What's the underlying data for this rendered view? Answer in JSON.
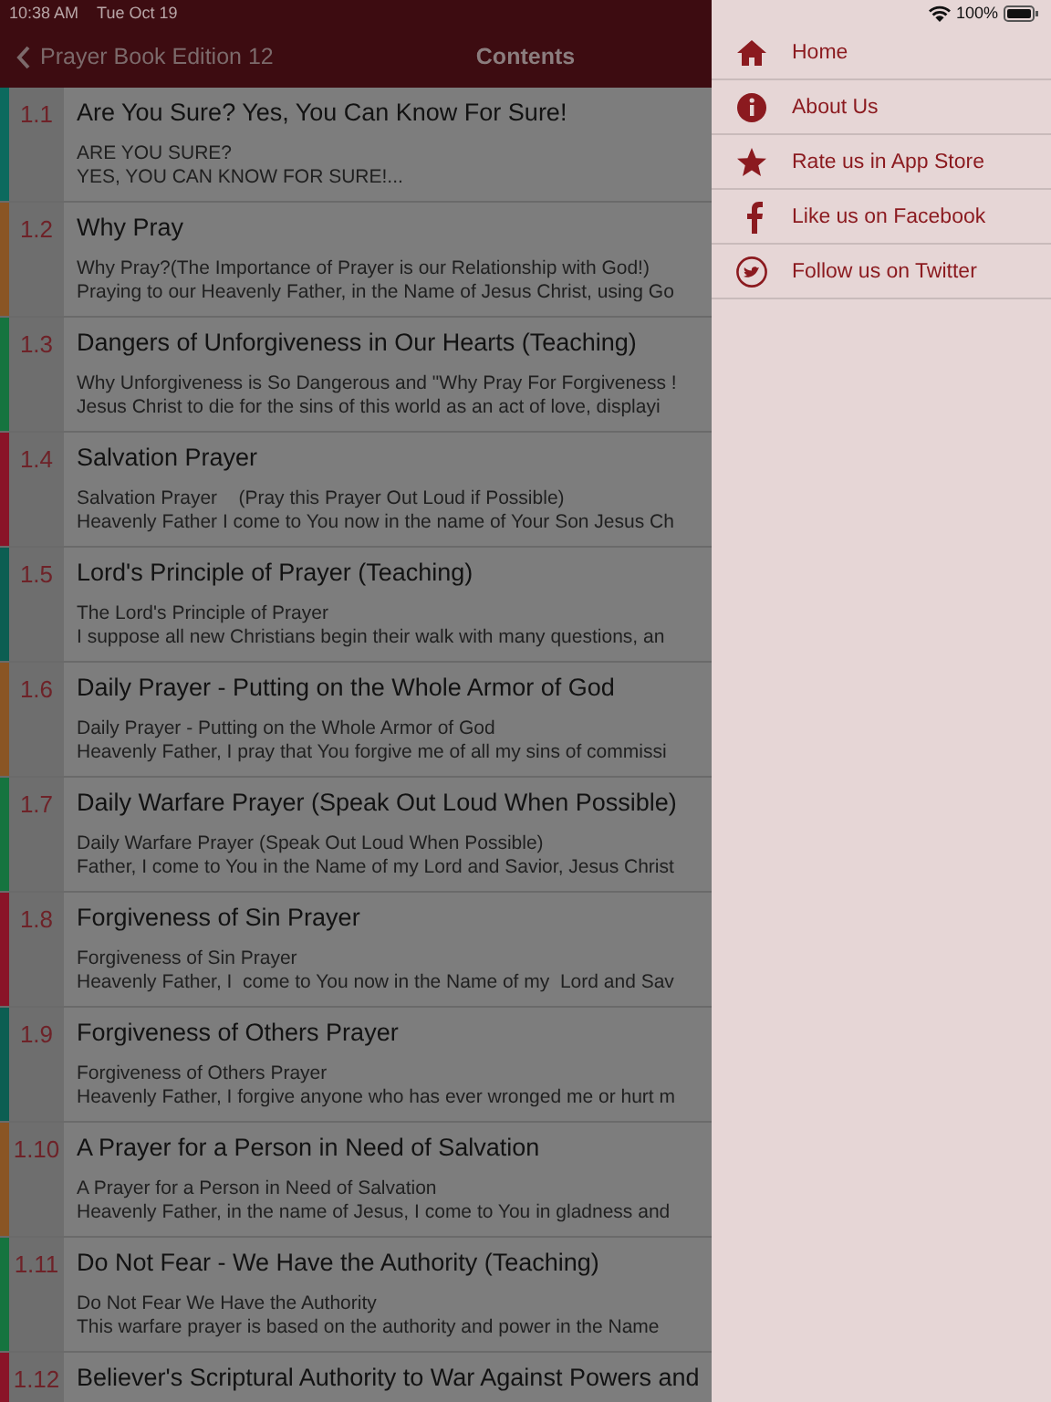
{
  "status_bar": {
    "time": "10:38 AM",
    "date": "Tue Oct 19",
    "battery": "100%"
  },
  "nav_bar": {
    "back_label": "Prayer Book Edition 12",
    "title": "Contents"
  },
  "contents": [
    {
      "number": "1.1",
      "title": "Are You Sure? Yes, You Can Know For Sure!",
      "lines": [
        "ARE YOU SURE?",
        "YES, YOU CAN KNOW FOR SURE!..."
      ],
      "color": "#0b6a5e"
    },
    {
      "number": "1.2",
      "title": "Why Pray",
      "lines": [
        "Why Pray?(The Importance of Prayer is our Relationship with God!)",
        "Praying to our Heavenly Father, in the Name of Jesus Christ, using Go"
      ],
      "color": "#8a5524"
    },
    {
      "number": "1.3",
      "title": "Dangers of Unforgiveness in Our Hearts (Teaching)",
      "lines": [
        "Why Unforgiveness is So Dangerous and \"Why Pray For Forgiveness !",
        "Jesus Christ to die for the sins of this world as an act of love, displayi"
      ],
      "color": "#15743f"
    },
    {
      "number": "1.4",
      "title": "Salvation Prayer",
      "lines": [
        "Salvation Prayer    (Pray this Prayer Out Loud if Possible)",
        "Heavenly Father I come to You now in the name of Your Son Jesus Ch"
      ],
      "color": "#8a1428"
    },
    {
      "number": "1.5",
      "title": "Lord's Principle of Prayer (Teaching)",
      "lines": [
        "The Lord's Principle of Prayer",
        "I suppose all new Christians begin their walk with many questions, an"
      ],
      "color": "#0b5e52"
    },
    {
      "number": "1.6",
      "title": "Daily Prayer - Putting on the Whole Armor of God",
      "lines": [
        "Daily Prayer - Putting on the Whole Armor of God",
        "Heavenly Father, I pray that You forgive me of all my sins of commissi"
      ],
      "color": "#8a5524"
    },
    {
      "number": "1.7",
      "title": "Daily Warfare Prayer (Speak Out Loud When Possible)",
      "lines": [
        "Daily Warfare Prayer (Speak Out Loud When Possible)",
        "Father, I come to You in the Name of my Lord and Savior, Jesus Christ"
      ],
      "color": "#15743f"
    },
    {
      "number": "1.8",
      "title": "Forgiveness of Sin Prayer",
      "lines": [
        "Forgiveness of Sin Prayer",
        "Heavenly Father, I  come to You now in the Name of my  Lord and Sav"
      ],
      "color": "#8a1428"
    },
    {
      "number": "1.9",
      "title": "Forgiveness of Others Prayer",
      "lines": [
        "Forgiveness of Others Prayer",
        "Heavenly Father, I forgive anyone who has ever wronged me or hurt m"
      ],
      "color": "#0b5e52"
    },
    {
      "number": "1.10",
      "title": "A Prayer for a Person in Need of Salvation",
      "lines": [
        "A Prayer for a Person in Need of Salvation",
        "Heavenly Father, in the name of Jesus, I come to You in gladness and"
      ],
      "color": "#8a5524"
    },
    {
      "number": "1.11",
      "title": "Do Not Fear - We Have the Authority (Teaching)",
      "lines": [
        "Do Not Fear We Have the Authority",
        "This warfare prayer is based on the authority and power in the Name"
      ],
      "color": "#15743f"
    },
    {
      "number": "1.12",
      "title": "Believer's Scriptural Authority to War Against Powers and",
      "color": "#8a1428"
    }
  ],
  "menu": {
    "items": [
      {
        "label": "Home"
      },
      {
        "label": "About Us"
      },
      {
        "label": "Rate us in App Store"
      },
      {
        "label": "Like us on Facebook"
      },
      {
        "label": "Follow us on Twitter"
      }
    ]
  }
}
